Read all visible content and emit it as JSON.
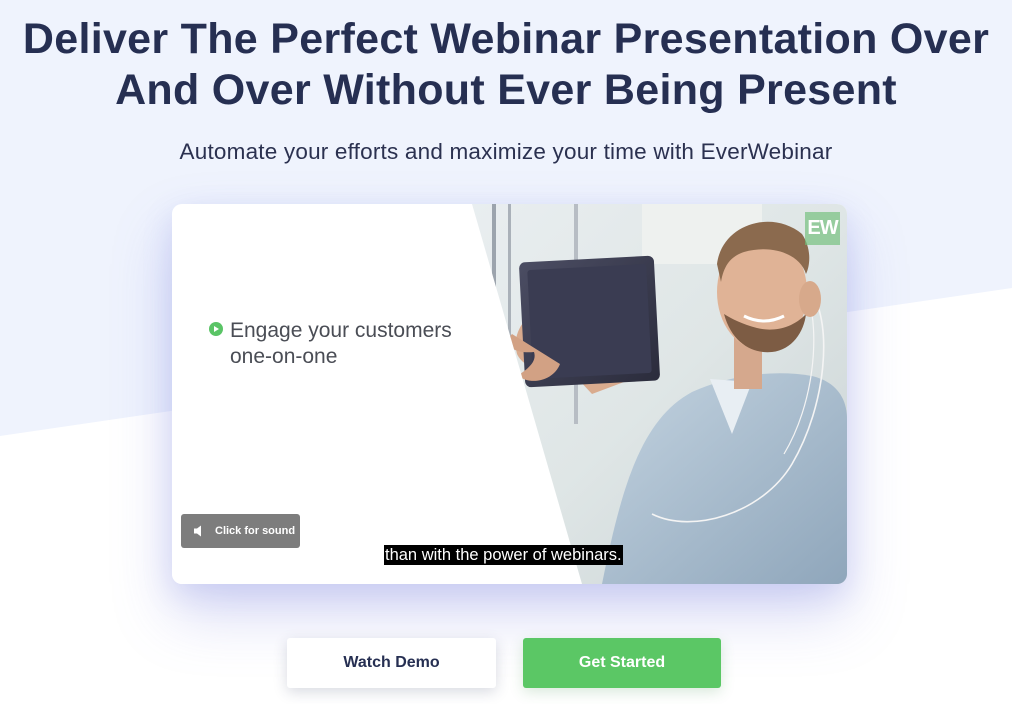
{
  "hero": {
    "headline_line1": "Deliver The Perfect Webinar Presentation Over",
    "headline_line2": "And Over Without Ever Being Present",
    "subheadline": "Automate your efforts and maximize your time with EverWebinar"
  },
  "video": {
    "bullet_line1": "Engage your customers",
    "bullet_line2": "one-on-one",
    "logo_text": "EW",
    "sound_button_label": "Click for sound",
    "caption": "than with the power of webinars."
  },
  "cta": {
    "watch_demo_label": "Watch Demo",
    "get_started_label": "Get Started"
  },
  "icons": {
    "bullet": "play-circle-icon",
    "sound": "speaker-icon"
  },
  "colors": {
    "headline": "#262f52",
    "background_band": "#eff3fd",
    "primary_green": "#5bc765",
    "caption_bg": "#000000",
    "sound_button_bg": "#7d7d7d"
  }
}
